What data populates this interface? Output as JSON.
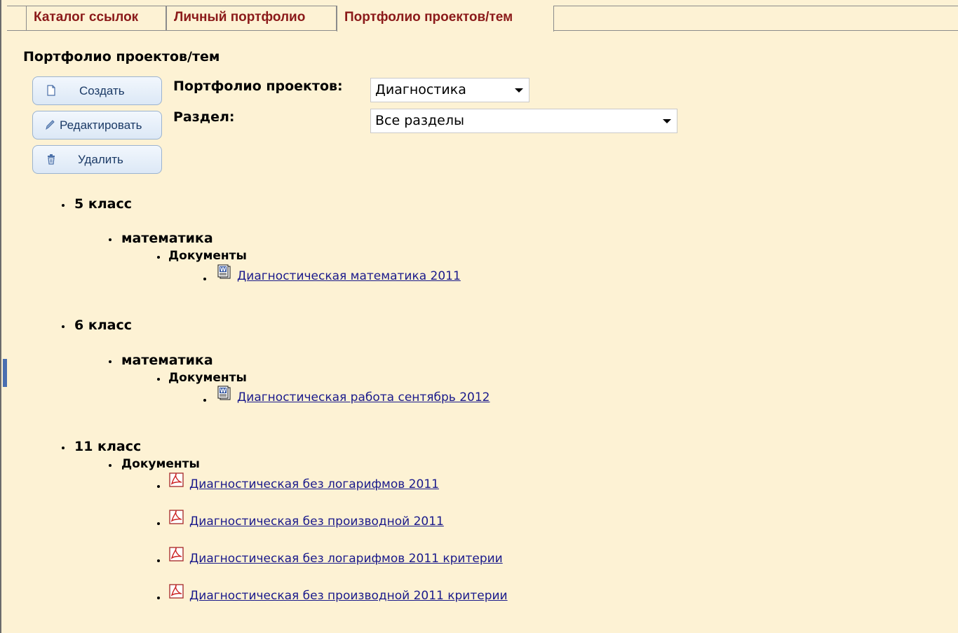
{
  "tabs": [
    {
      "label": "Каталог ссылок",
      "active": false
    },
    {
      "label": "Личный портфолио",
      "active": false
    },
    {
      "label": "Портфолио проектов/тем",
      "active": true
    }
  ],
  "page_title": "Портфолио проектов/тем",
  "toolbar": {
    "create_label": "Создать",
    "edit_label": "Редактировать",
    "delete_label": "Удалить"
  },
  "filters": {
    "portfolio_label": "Портфолио проектов:",
    "portfolio_value": "Диагностика",
    "section_label": "Раздел:",
    "section_value": "Все разделы"
  },
  "tree": {
    "grade5": {
      "label": "5 класс",
      "subject": "математика",
      "folder": "Документы",
      "doc1": "Диагностическая математика 2011"
    },
    "grade6": {
      "label": "6 класс",
      "subject": "математика",
      "folder": "Документы",
      "doc1": "Диагностическая работа сентябрь 2012"
    },
    "grade11": {
      "label": "11 класс",
      "folder": "Документы",
      "doc1": "Диагностическая без логарифмов 2011",
      "doc2": "Диагностическая без производной 2011",
      "doc3": "Диагностическая без логарифмов 2011 критерии",
      "doc4": "Диагностическая без производной 2011 критерии"
    }
  },
  "colors": {
    "background": "#fdf2d4",
    "tab_text": "#8b1a1a",
    "link": "#1a1a8b",
    "button_text": "#1b3a66"
  },
  "icons": {
    "word_doc": "word-doc-icon",
    "pdf_doc": "pdf-doc-icon"
  }
}
